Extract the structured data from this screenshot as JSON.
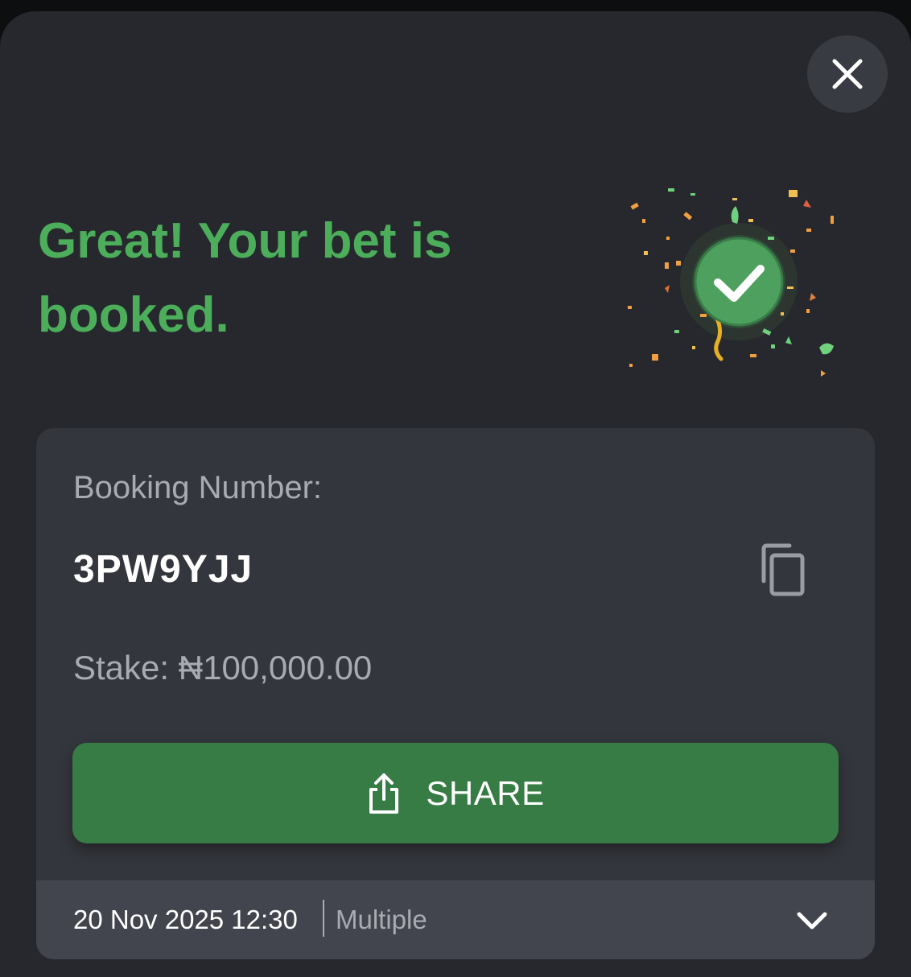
{
  "dialog": {
    "headline": "Great! Your bet is booked.",
    "close_icon": "close-icon",
    "success_icon": "checkmark-confetti-icon"
  },
  "booking": {
    "label": "Booking Number:",
    "code": "3PW9YJJ",
    "copy_icon": "copy-icon",
    "stake_label": "Stake:",
    "stake_value": "₦100,000.00"
  },
  "share_button": {
    "label": "SHARE",
    "icon": "share-icon"
  },
  "footer": {
    "date": "20 Nov 2025 12:30",
    "bet_type": "Multiple",
    "expand_icon": "chevron-down-icon"
  },
  "colors": {
    "background": "#26282d",
    "card": "#34363d",
    "accent_green": "#4cae5b",
    "button_green": "#367c44",
    "muted_text": "#a9abb2"
  }
}
